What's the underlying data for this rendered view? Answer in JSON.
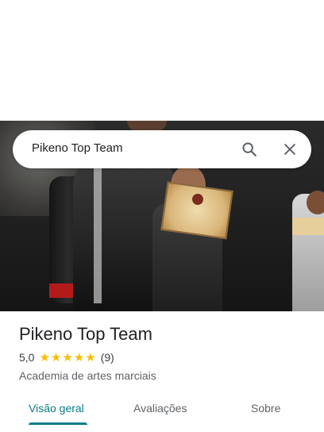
{
  "search": {
    "query": "Pikeno Top Team",
    "search_icon": "search-icon",
    "close_icon": "close-icon"
  },
  "place": {
    "name": "Pikeno Top Team",
    "rating": "5,0",
    "stars": 5,
    "review_count": "(9)",
    "category": "Academia de artes marciais"
  },
  "tabs": [
    {
      "label": "Visão geral",
      "active": true
    },
    {
      "label": "Avaliações",
      "active": false
    },
    {
      "label": "Sobre",
      "active": false
    }
  ],
  "colors": {
    "accent": "#0a7d88",
    "star": "#fbbc04"
  }
}
